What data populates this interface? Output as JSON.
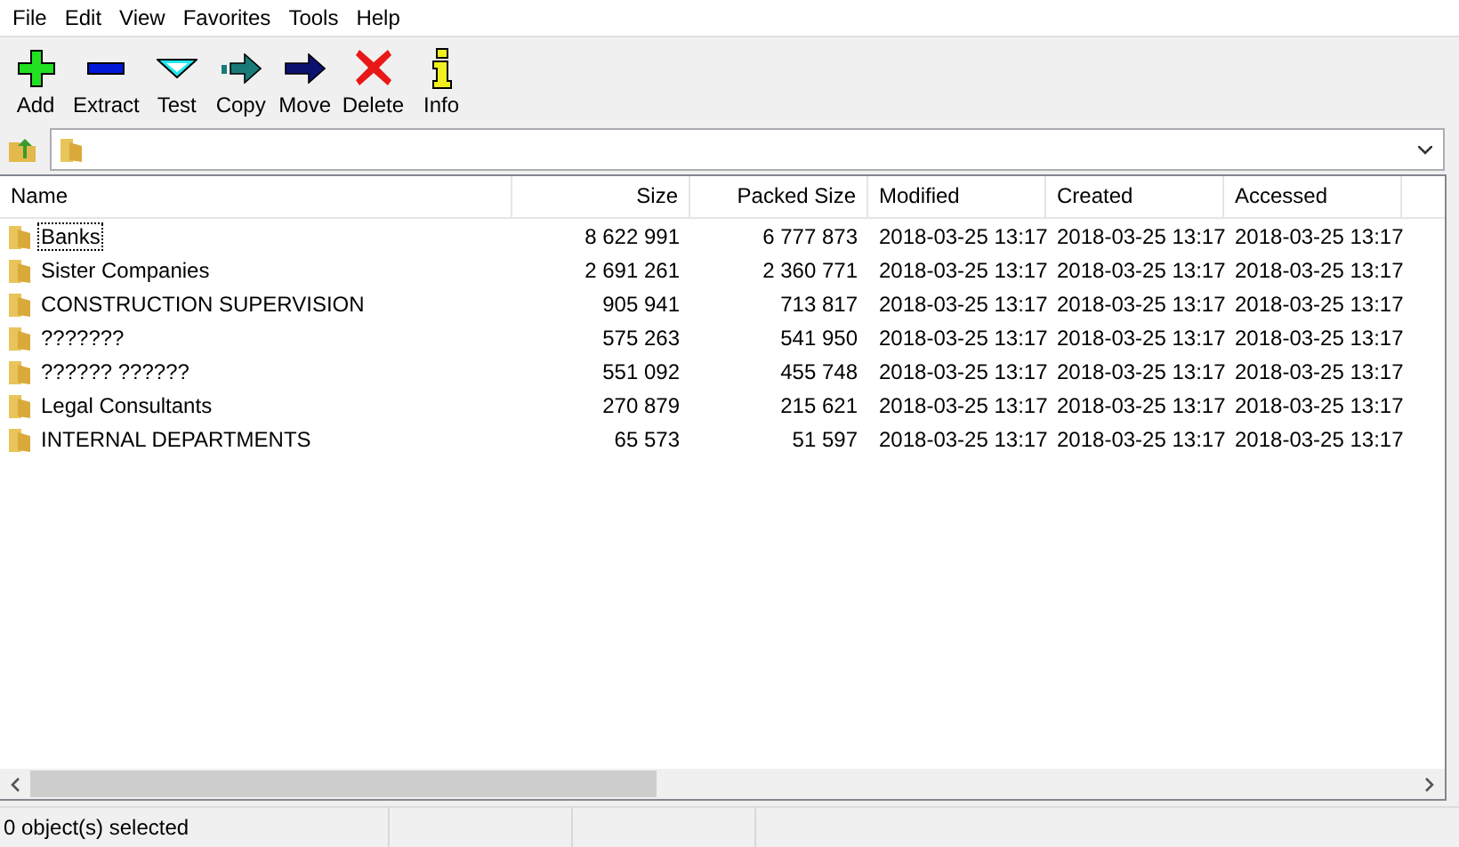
{
  "menu": [
    "File",
    "Edit",
    "View",
    "Favorites",
    "Tools",
    "Help"
  ],
  "toolbar": [
    {
      "kind": "add",
      "label": "Add"
    },
    {
      "kind": "extract",
      "label": "Extract"
    },
    {
      "kind": "test",
      "label": "Test"
    },
    {
      "kind": "copy",
      "label": "Copy"
    },
    {
      "kind": "move",
      "label": "Move"
    },
    {
      "kind": "delete",
      "label": "Delete"
    },
    {
      "kind": "info",
      "label": "Info"
    }
  ],
  "table": {
    "columns": [
      "Name",
      "Size",
      "Packed Size",
      "Modified",
      "Created",
      "Accessed"
    ],
    "rows": [
      {
        "focused": true,
        "cells": [
          "Banks",
          "8 622 991",
          "6 777 873",
          "2018-03-25 13:17",
          "2018-03-25 13:17",
          "2018-03-25 13:17"
        ]
      },
      {
        "focused": false,
        "cells": [
          "Sister Companies",
          "2 691 261",
          "2 360 771",
          "2018-03-25 13:17",
          "2018-03-25 13:17",
          "2018-03-25 13:17"
        ]
      },
      {
        "focused": false,
        "cells": [
          "CONSTRUCTION SUPERVISION",
          "905 941",
          "713 817",
          "2018-03-25 13:17",
          "2018-03-25 13:17",
          "2018-03-25 13:17"
        ]
      },
      {
        "focused": false,
        "cells": [
          "???????",
          "575 263",
          "541 950",
          "2018-03-25 13:17",
          "2018-03-25 13:17",
          "2018-03-25 13:17"
        ]
      },
      {
        "focused": false,
        "cells": [
          "?????? ??????",
          "551 092",
          "455 748",
          "2018-03-25 13:17",
          "2018-03-25 13:17",
          "2018-03-25 13:17"
        ]
      },
      {
        "focused": false,
        "cells": [
          "Legal Consultants",
          "270 879",
          "215 621",
          "2018-03-25 13:17",
          "2018-03-25 13:17",
          "2018-03-25 13:17"
        ]
      },
      {
        "focused": false,
        "cells": [
          "INTERNAL DEPARTMENTS",
          "65 573",
          "51 597",
          "2018-03-25 13:17",
          "2018-03-25 13:17",
          "2018-03-25 13:17"
        ]
      }
    ]
  },
  "status_bar": [
    "0 object(s) selected"
  ]
}
